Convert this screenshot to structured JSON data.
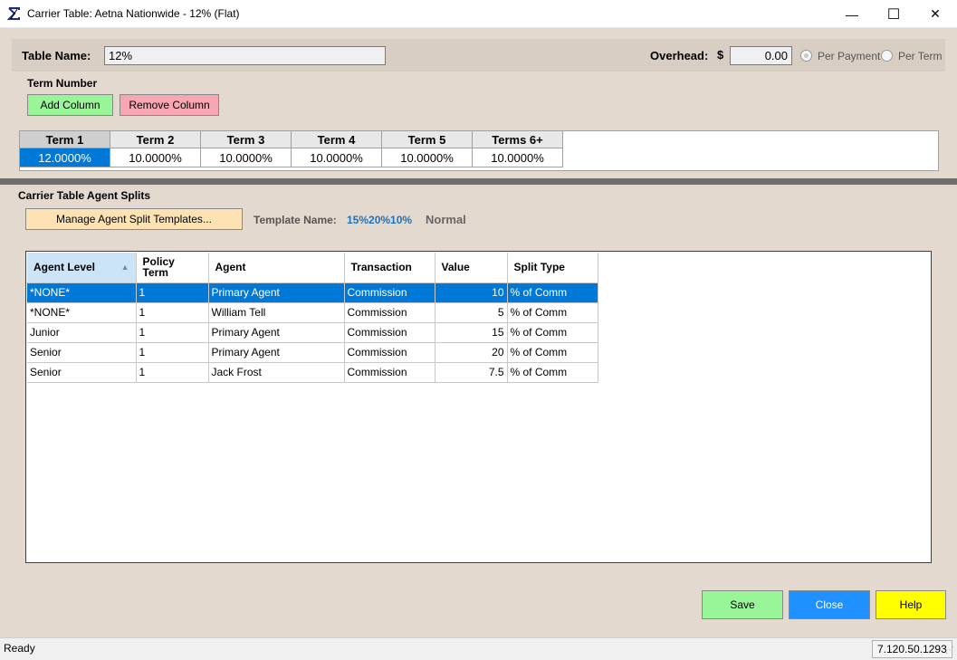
{
  "window": {
    "title": "Carrier Table: Aetna Nationwide - 12% (Flat)",
    "minimize": "—",
    "maximize": "☐",
    "close": "✕"
  },
  "header": {
    "table_name_label": "Table Name:",
    "table_name_value": "12%",
    "overhead_label": "Overhead:",
    "currency": "$",
    "overhead_value": "0.00",
    "per_payment_label": "Per Payment",
    "per_term_label": "Per Term"
  },
  "terms": {
    "section_label": "Term Number",
    "add_column": "Add Column",
    "remove_column": "Remove Column",
    "columns": [
      {
        "header": "Term 1",
        "value": "12.0000%"
      },
      {
        "header": "Term 2",
        "value": "10.0000%"
      },
      {
        "header": "Term 3",
        "value": "10.0000%"
      },
      {
        "header": "Term 4",
        "value": "10.0000%"
      },
      {
        "header": "Term 5",
        "value": "10.0000%"
      },
      {
        "header": "Terms 6+",
        "value": "10.0000%"
      }
    ]
  },
  "splits": {
    "section_label": "Carrier Table Agent Splits",
    "manage_button": "Manage Agent Split Templates...",
    "template_name_label": "Template Name:",
    "template_name_value": "15%20%10%",
    "template_mode": "Normal",
    "columns": [
      "Agent Level",
      "Policy Term",
      "Agent",
      "Transaction",
      "Value",
      "Split Type"
    ],
    "rows": [
      {
        "level": "*NONE*",
        "term": "1",
        "agent": "Primary Agent",
        "transaction": "Commission",
        "value": "10",
        "split_type": "% of Comm"
      },
      {
        "level": "*NONE*",
        "term": "1",
        "agent": "William Tell",
        "transaction": "Commission",
        "value": "5",
        "split_type": "% of Comm"
      },
      {
        "level": "Junior",
        "term": "1",
        "agent": "Primary Agent",
        "transaction": "Commission",
        "value": "15",
        "split_type": "% of Comm"
      },
      {
        "level": "Senior",
        "term": "1",
        "agent": "Primary Agent",
        "transaction": "Commission",
        "value": "20",
        "split_type": "% of Comm"
      },
      {
        "level": "Senior",
        "term": "1",
        "agent": "Jack Frost",
        "transaction": "Commission",
        "value": "7.5",
        "split_type": "% of Comm"
      }
    ]
  },
  "footer": {
    "save": "Save",
    "close": "Close",
    "help": "Help"
  },
  "status": {
    "text": "Ready",
    "version": "7.120.50.1293"
  },
  "colors": {
    "save": "#98f598",
    "close": "#1e90ff",
    "help": "#ffff00",
    "add": "#98f598",
    "remove": "#f8a5b4",
    "manage": "#fde3b3",
    "template_value": "#1e73be"
  }
}
